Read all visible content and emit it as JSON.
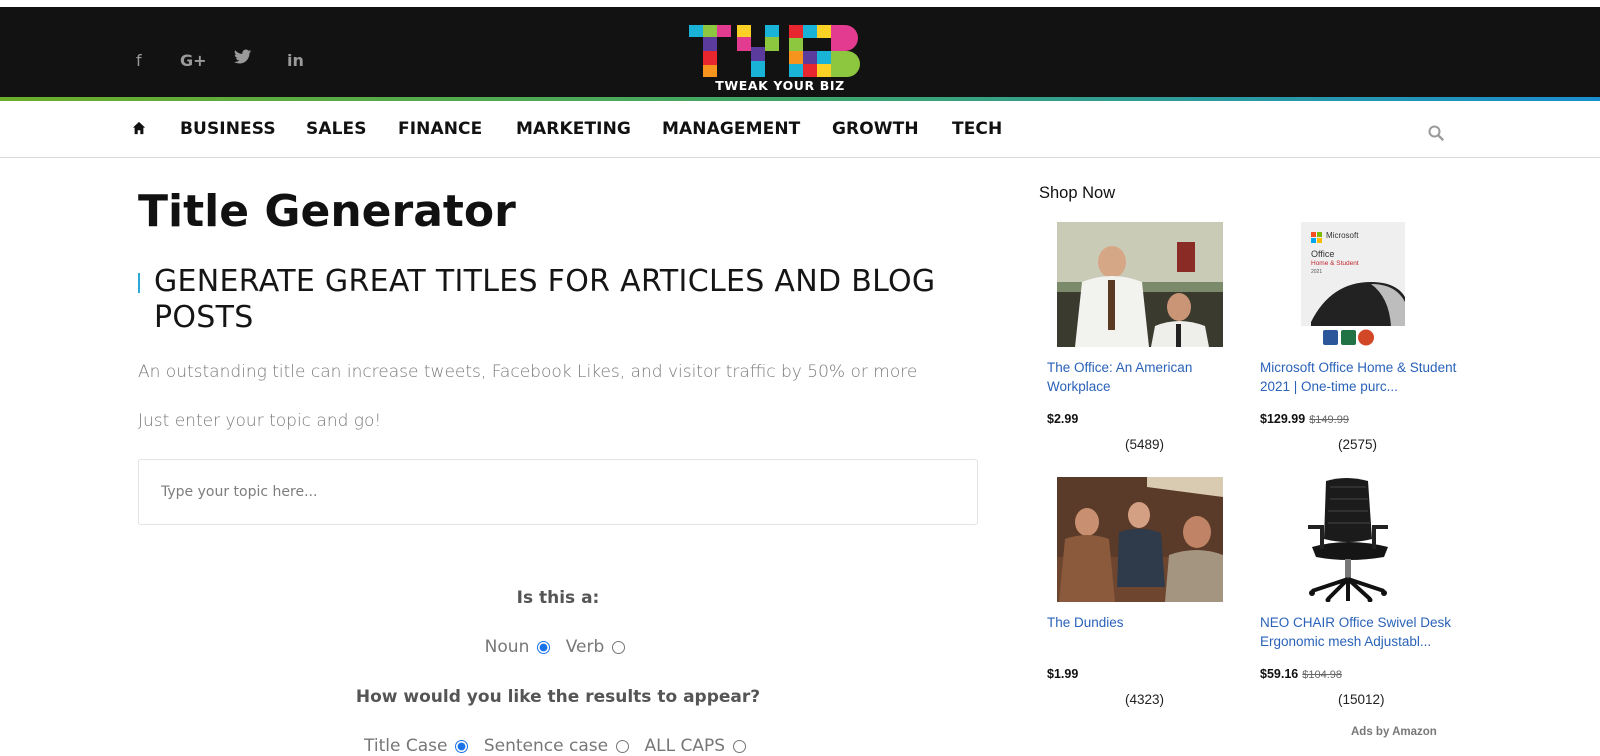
{
  "header": {
    "social": [
      {
        "icon": "facebook-icon",
        "glyph": "f"
      },
      {
        "icon": "google-plus-icon",
        "glyph": "G+"
      },
      {
        "icon": "twitter-icon",
        "glyph": "🐦"
      },
      {
        "icon": "linkedin-icon",
        "glyph": "in"
      }
    ],
    "logo_letters": "TYB",
    "logo_sub": "TWEAK YOUR BIZ",
    "colors": {
      "background": "#121212",
      "accent_start": "#6cae2a",
      "accent_end": "#1a8fd0"
    }
  },
  "nav": {
    "items": [
      "BUSINESS",
      "SALES",
      "FINANCE",
      "MARKETING",
      "MANAGEMENT",
      "GROWTH",
      "TECH"
    ]
  },
  "main": {
    "title": "Title Generator",
    "subtitle": "GENERATE GREAT TITLES FOR ARTICLES AND BLOG POSTS",
    "lead1": "An outstanding title can increase tweets, Facebook Likes, and visitor traffic by 50% or more",
    "lead2": "Just enter your topic and go!",
    "topic_placeholder": "Type your topic here...",
    "q1": "Is this a:",
    "q1_options": [
      "Noun",
      "Verb"
    ],
    "q1_selected": "Noun",
    "q2": "How would you like the results to appear?",
    "q2_options": [
      "Title Case",
      "Sentence case",
      "ALL CAPS"
    ],
    "q2_selected": "Title Case"
  },
  "sidebar": {
    "title": "Shop Now",
    "products": [
      {
        "name": "The Office: An American Workplace",
        "price": "$2.99",
        "old_price": "",
        "reviews": "(5489)"
      },
      {
        "name": "Microsoft Office Home & Student 2021 | One-time purc...",
        "price": "$129.99",
        "old_price": "$149.99",
        "reviews": "(2575)",
        "box_brand": "Microsoft",
        "box_line1": "Office",
        "box_line2": "Home & Student",
        "box_year": "2021"
      },
      {
        "name": "The Dundies",
        "price": "$1.99",
        "old_price": "",
        "reviews": "(4323)"
      },
      {
        "name": "NEO CHAIR Office Swivel Desk Ergonomic mesh Adjustabl...",
        "price": "$59.16",
        "old_price": "$104.98",
        "reviews": "(15012)"
      }
    ],
    "ads_by": "Ads by Amazon"
  }
}
